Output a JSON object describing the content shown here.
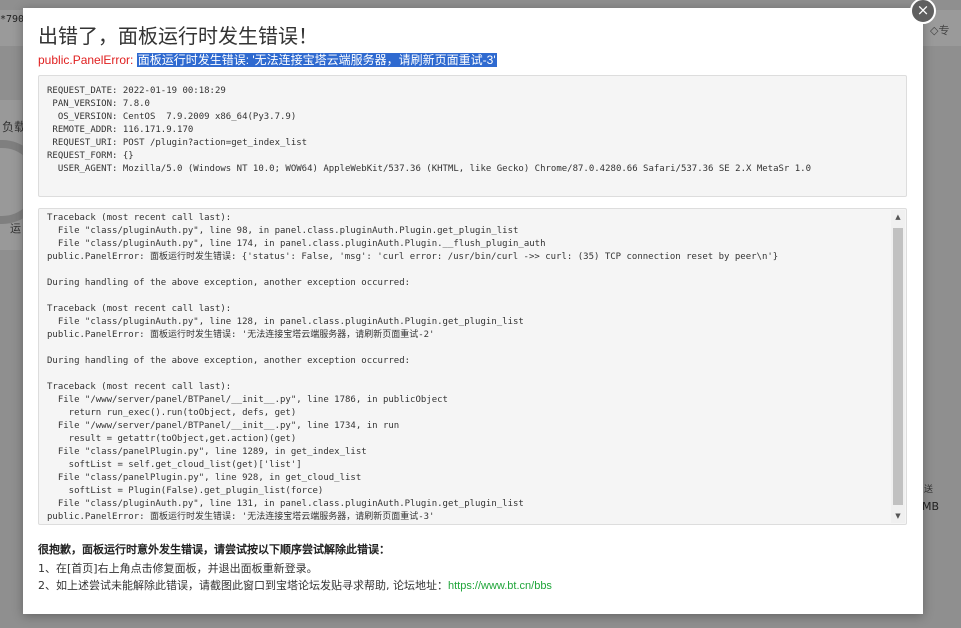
{
  "background": {
    "left_text": "*790",
    "label_load": "负载",
    "label_run": "运",
    "right_badge": "专",
    "right_small": "送",
    "right_mb": "MB"
  },
  "dialog": {
    "close_icon": "×",
    "title": "出错了，面板运行时发生错误！",
    "error_prefix": "public.PanelError: ",
    "error_message": "面板运行时发生错误: '无法连接宝塔云端服务器，请刷新页面重试-3'",
    "info_lines": [
      "REQUEST_DATE: 2022-01-19 00:18:29",
      " PAN_VERSION: 7.8.0",
      "  OS_VERSION: CentOS  7.9.2009 x86_64(Py3.7.9)",
      " REMOTE_ADDR: 116.171.9.170",
      " REQUEST_URI: POST /plugin?action=get_index_list",
      "REQUEST_FORM: {}",
      "  USER_AGENT: Mozilla/5.0 (Windows NT 10.0; WOW64) AppleWebKit/537.36 (KHTML, like Gecko) Chrome/87.0.4280.66 Safari/537.36 SE 2.X MetaSr 1.0"
    ],
    "trace_lines": [
      "Traceback (most recent call last):",
      "  File \"class/pluginAuth.py\", line 98, in panel.class.pluginAuth.Plugin.get_plugin_list",
      "  File \"class/pluginAuth.py\", line 174, in panel.class.pluginAuth.Plugin.__flush_plugin_auth",
      "public.PanelError: 面板运行时发生错误: {'status': False, 'msg': 'curl error: /usr/bin/curl ->> curl: (35) TCP connection reset by peer\\n'}",
      "",
      "During handling of the above exception, another exception occurred:",
      "",
      "Traceback (most recent call last):",
      "  File \"class/pluginAuth.py\", line 128, in panel.class.pluginAuth.Plugin.get_plugin_list",
      "public.PanelError: 面板运行时发生错误: '无法连接宝塔云端服务器，请刷新页面重试-2'",
      "",
      "During handling of the above exception, another exception occurred:",
      "",
      "Traceback (most recent call last):",
      "  File \"/www/server/panel/BTPanel/__init__.py\", line 1786, in publicObject",
      "    return run_exec().run(toObject, defs, get)",
      "  File \"/www/server/panel/BTPanel/__init__.py\", line 1734, in run",
      "    result = getattr(toObject,get.action)(get)",
      "  File \"class/panelPlugin.py\", line 1289, in get_index_list",
      "    softList = self.get_cloud_list(get)['list']",
      "  File \"class/panelPlugin.py\", line 928, in get_cloud_list",
      "    softList = Plugin(False).get_plugin_list(force)",
      "  File \"class/pluginAuth.py\", line 131, in panel.class.pluginAuth.Plugin.get_plugin_list",
      "public.PanelError: 面板运行时发生错误: '无法连接宝塔云端服务器，请刷新页面重试-3'"
    ],
    "help_title": "很抱歉，面板运行时意外发生错误，请尝试按以下顺序尝试解除此错误：",
    "help_1": "1、在[首页]右上角点击修复面板，并退出面板重新登录。",
    "help_2_text": "2、如上述尝试未能解除此错误，请截图此窗口到宝塔论坛发贴寻求帮助, 论坛地址：",
    "help_2_link": "https://www.bt.cn/bbs"
  }
}
